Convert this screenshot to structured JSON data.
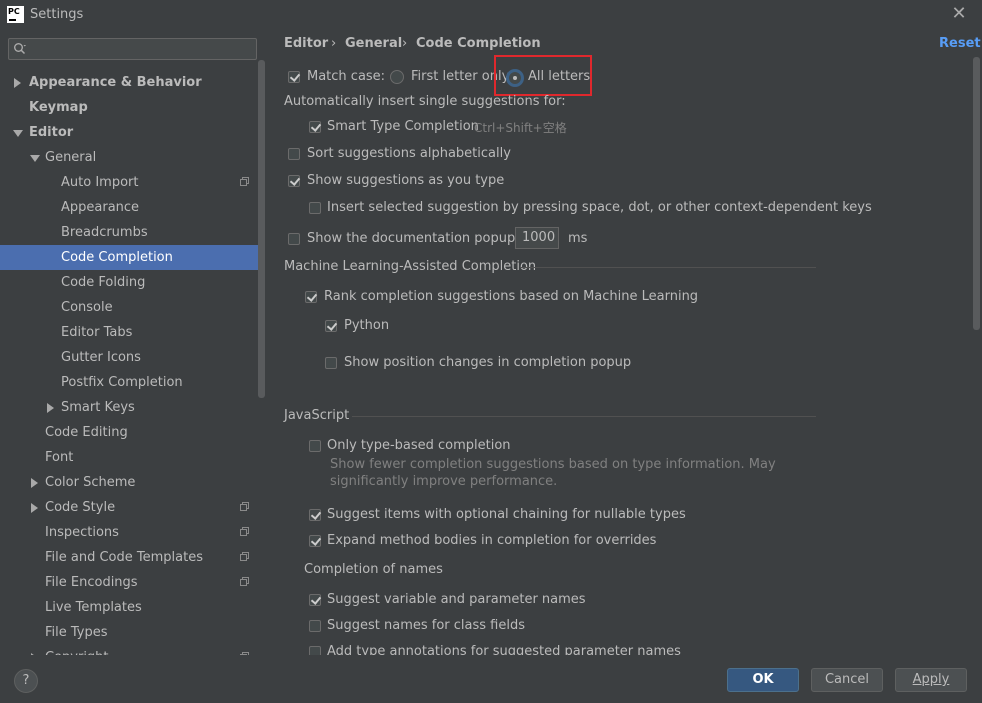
{
  "window": {
    "title": "Settings",
    "logo_text": "PC"
  },
  "sidebar": {
    "search_placeholder": "",
    "items": [
      {
        "label": "Appearance & Behavior"
      },
      {
        "label": "Keymap"
      },
      {
        "label": "Editor"
      },
      {
        "label": "General"
      },
      {
        "label": "Auto Import"
      },
      {
        "label": "Appearance"
      },
      {
        "label": "Breadcrumbs"
      },
      {
        "label": "Code Completion"
      },
      {
        "label": "Code Folding"
      },
      {
        "label": "Console"
      },
      {
        "label": "Editor Tabs"
      },
      {
        "label": "Gutter Icons"
      },
      {
        "label": "Postfix Completion"
      },
      {
        "label": "Smart Keys"
      },
      {
        "label": "Code Editing"
      },
      {
        "label": "Font"
      },
      {
        "label": "Color Scheme"
      },
      {
        "label": "Code Style"
      },
      {
        "label": "Inspections"
      },
      {
        "label": "File and Code Templates"
      },
      {
        "label": "File Encodings"
      },
      {
        "label": "Live Templates"
      },
      {
        "label": "File Types"
      },
      {
        "label": "Copyright"
      }
    ]
  },
  "breadcrumb": {
    "part1": "Editor",
    "part2": "General",
    "part3": "Code Completion",
    "sep": "›"
  },
  "reset_label": "Reset",
  "settings": {
    "match_case": "Match case:",
    "first_letter_only": "First letter only",
    "all_letters": "All letters",
    "auto_insert_heading": "Automatically insert single suggestions for:",
    "smart_type": "Smart Type Completion",
    "smart_type_shortcut": "Ctrl+Shift+空格",
    "sort_alpha": "Sort suggestions alphabetically",
    "show_as_type": "Show suggestions as you type",
    "insert_selected": "Insert selected suggestion by pressing space, dot, or other context-dependent keys",
    "show_doc_popup": "Show the documentation popup in",
    "doc_delay": "1000",
    "ms": "ms",
    "ml_heading": "Machine Learning-Assisted Completion",
    "rank_ml": "Rank completion suggestions based on Machine Learning",
    "python": "Python",
    "show_position_changes": "Show position changes in completion popup",
    "js_heading": "JavaScript",
    "only_type_based": "Only type-based completion",
    "only_type_based_desc1": "Show fewer completion suggestions based on type information. May",
    "only_type_based_desc2": "significantly improve performance.",
    "optional_chaining": "Suggest items with optional chaining for nullable types",
    "expand_method_bodies": "Expand method bodies in completion for overrides",
    "completion_of_names": "Completion of names",
    "suggest_var_names": "Suggest variable and parameter names",
    "suggest_class_fields": "Suggest names for class fields",
    "add_type_annotations": "Add type annotations for suggested parameter names"
  },
  "footer": {
    "help": "?",
    "ok": "OK",
    "cancel": "Cancel",
    "apply": "Apply"
  },
  "colors": {
    "background": "#3c3f41",
    "selection": "#4b6eaf",
    "link": "#589df6",
    "highlight": "#e0282d",
    "primary_button": "#365880"
  }
}
